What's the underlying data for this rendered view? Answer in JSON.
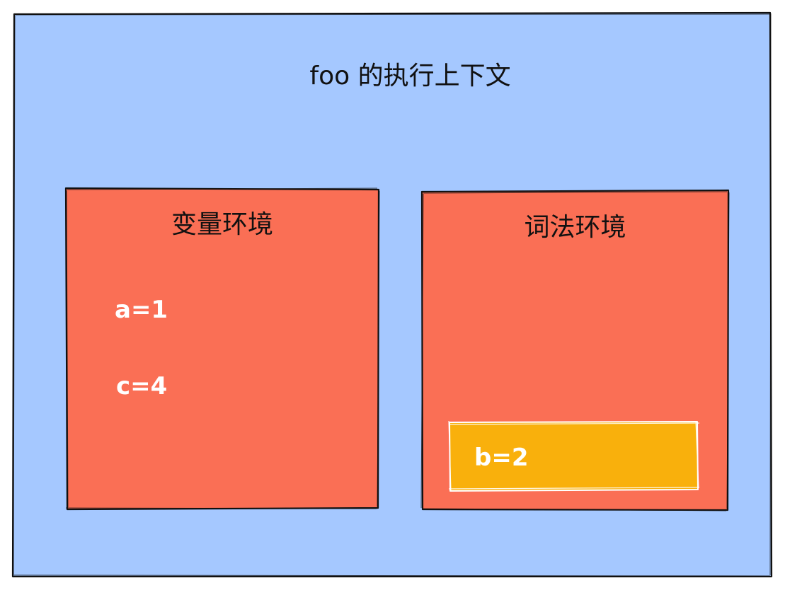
{
  "context": {
    "title": "foo 的执行上下文"
  },
  "variable_environment": {
    "label": "变量环境",
    "entries": [
      "a=1",
      "c=4"
    ]
  },
  "lexical_environment": {
    "label": "词法环境",
    "block": {
      "entries": [
        "b=2"
      ]
    }
  },
  "colors": {
    "outer_fill": "#a5c8ff",
    "env_fill": "#fa6f55",
    "block_fill": "#f9b00c",
    "stroke": "#111111",
    "block_stroke": "#ffffff"
  }
}
